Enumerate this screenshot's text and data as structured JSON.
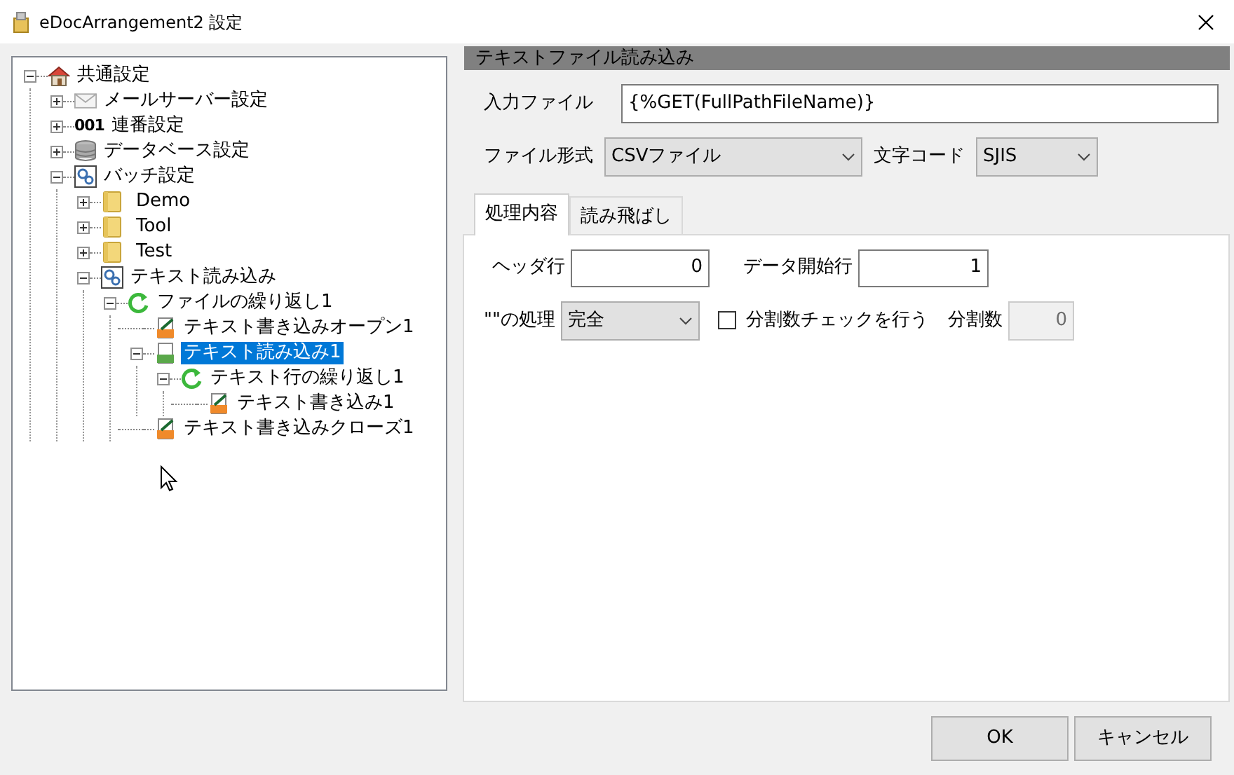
{
  "window": {
    "title": "eDocArrangement2 設定"
  },
  "tree": [
    {
      "label": "共通設定",
      "kind": "home",
      "expanded": true,
      "selected": false,
      "children": [
        {
          "label": "メールサーバー設定",
          "kind": "mail",
          "expanded": false,
          "selected": false
        },
        {
          "label": "連番設定",
          "kind": "number",
          "icon_text": "001",
          "expanded": false,
          "selected": false
        },
        {
          "label": "データベース設定",
          "kind": "database",
          "expanded": false,
          "selected": false
        },
        {
          "label": "バッチ設定",
          "kind": "batch",
          "expanded": true,
          "selected": false,
          "children": [
            {
              "label": "Demo",
              "kind": "folder",
              "expanded": false,
              "selected": false
            },
            {
              "label": "Tool",
              "kind": "folder",
              "expanded": false,
              "selected": false
            },
            {
              "label": "Test",
              "kind": "folder",
              "expanded": false,
              "selected": false
            },
            {
              "label": "テキスト読み込み",
              "kind": "batch",
              "expanded": true,
              "selected": false,
              "children": [
                {
                  "label": "ファイルの繰り返し1",
                  "kind": "loop",
                  "expanded": true,
                  "selected": false,
                  "children": [
                    {
                      "label": "テキスト書き込みオープン1",
                      "kind": "txt-write",
                      "selected": false
                    },
                    {
                      "label": "テキスト読み込み1",
                      "kind": "txt-read",
                      "expanded": true,
                      "selected": true,
                      "children": [
                        {
                          "label": "テキスト行の繰り返し1",
                          "kind": "loop",
                          "expanded": true,
                          "selected": false,
                          "children": [
                            {
                              "label": "テキスト書き込み1",
                              "kind": "txt-write",
                              "selected": false
                            }
                          ]
                        }
                      ]
                    },
                    {
                      "label": "テキスト書き込みクローズ1",
                      "kind": "txt-write",
                      "selected": false
                    }
                  ]
                }
              ]
            }
          ]
        }
      ]
    }
  ],
  "panel": {
    "title": "テキストファイル読み込み",
    "input_file": {
      "label": "入力ファイル",
      "value": "{%GET(FullPathFileName)}"
    },
    "file_format": {
      "label": "ファイル形式",
      "value": "CSVファイル"
    },
    "encoding": {
      "label": "文字コード",
      "value": "SJIS"
    },
    "tabs": [
      {
        "label": "処理内容",
        "selected": true
      },
      {
        "label": "読み飛ばし",
        "selected": false
      }
    ],
    "header_row": {
      "label": "ヘッダ行",
      "value": "0"
    },
    "data_start_row": {
      "label": "データ開始行",
      "value": "1"
    },
    "quote_handling": {
      "label": "\"\"の処理",
      "value": "完全"
    },
    "split_check": {
      "label": "分割数チェックを行う",
      "checked": false
    },
    "split_count": {
      "label": "分割数",
      "value": "0",
      "disabled": true
    }
  },
  "buttons": [
    "OK",
    "キャンセル"
  ]
}
